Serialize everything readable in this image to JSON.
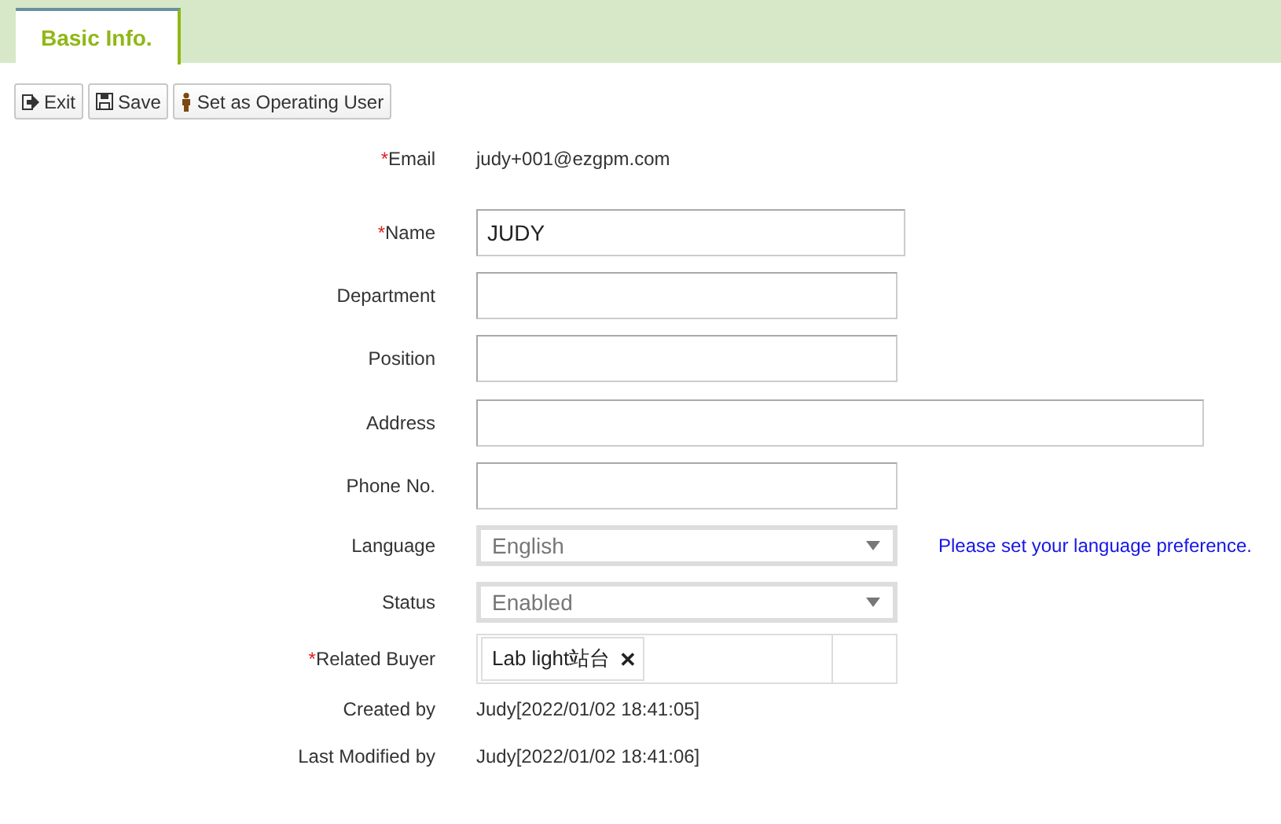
{
  "tabs": [
    {
      "label": "Basic Info.",
      "selected": true
    }
  ],
  "toolbar": [
    {
      "kind": "exit",
      "label": "Exit"
    },
    {
      "kind": "save",
      "label": "Save"
    },
    {
      "kind": "user",
      "label": "Set as Operating User"
    }
  ],
  "fields": [
    {
      "kind": "text",
      "label": "Email",
      "required_mark": "*",
      "value": "judy+001@ezgpm.com"
    },
    {
      "kind": "input",
      "label": "Name",
      "required_mark": "*",
      "value": "JUDY"
    },
    {
      "kind": "input",
      "label": "Department"
    },
    {
      "kind": "input",
      "label": "Position"
    },
    {
      "kind": "long_input",
      "label": "Address"
    },
    {
      "kind": "input",
      "label": "Phone No."
    },
    {
      "kind": "select",
      "label": "Language",
      "value": "English",
      "hint": "Please set your language preference."
    },
    {
      "kind": "select",
      "label": "Status",
      "value": "Enabled"
    },
    {
      "kind": "tags",
      "label": "Related Buyer",
      "required_mark": "*",
      "tags": [
        {
          "label": "Lab light站台",
          "remove": "✕"
        }
      ]
    },
    {
      "kind": "text",
      "label": "Created by",
      "value": "Judy[2022/01/02 18:41:05]"
    },
    {
      "kind": "text",
      "label": "Last Modified by",
      "value": "Judy[2022/01/02 18:41:06]"
    }
  ]
}
